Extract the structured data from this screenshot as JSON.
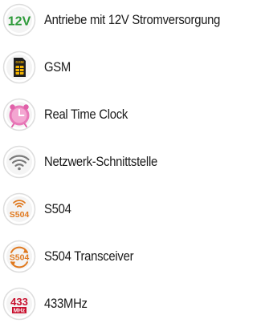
{
  "features": [
    {
      "label": "Antriebe mit 12V Stromversorgung",
      "icon": "12v-power-icon",
      "icon_text": "12V",
      "color": "#2e9a3a"
    },
    {
      "label": "GSM",
      "icon": "gsm-sim-icon",
      "icon_text": "GSM",
      "color": "#f2b200"
    },
    {
      "label": "Real Time Clock",
      "icon": "clock-icon",
      "color": "#e060a8"
    },
    {
      "label": "Netzwerk-Schnittstelle",
      "icon": "wifi-icon",
      "color": "#8a8a8a"
    },
    {
      "label": "S504",
      "icon": "s504-radio-icon",
      "icon_text": "S504",
      "color": "#e07a20"
    },
    {
      "label": "S504 Transceiver",
      "icon": "s504-transceiver-icon",
      "icon_text": "S504",
      "color": "#e07a20"
    },
    {
      "label": "433MHz",
      "icon": "433mhz-icon",
      "icon_text": "433",
      "icon_subtext": "MHz",
      "color": "#c8102e"
    }
  ]
}
